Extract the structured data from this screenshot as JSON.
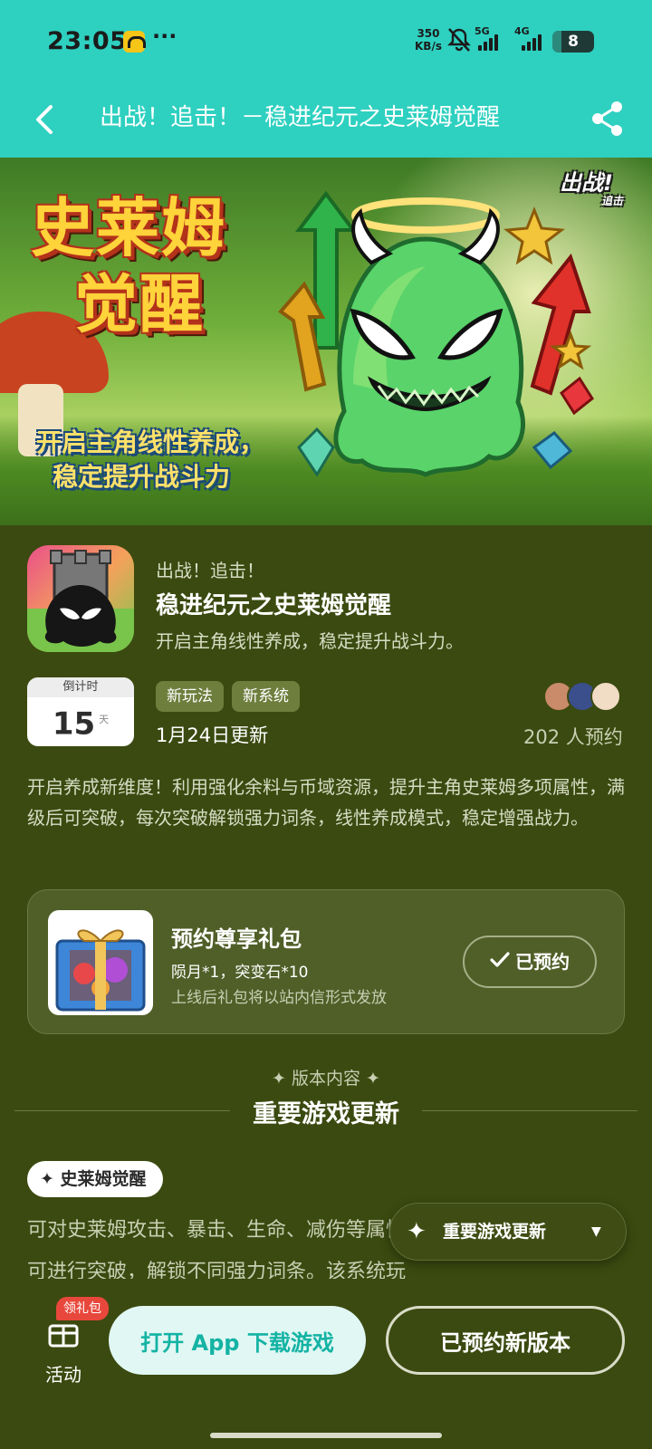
{
  "status_bar": {
    "time": "23:05",
    "more": "···",
    "speed_value": "350",
    "speed_unit": "KB/s",
    "net1": "5G",
    "net2": "4G",
    "battery": "8"
  },
  "nav": {
    "title": "出战！追击！－稳进纪元之史莱姆觉醒"
  },
  "banner": {
    "title_line1": "史莱姆",
    "title_line2": "觉醒",
    "subtitle_line1": "开启主角线性养成，",
    "subtitle_line2": "稳定提升战斗力",
    "badge": "出战!",
    "badge_small": "追击"
  },
  "game": {
    "line1": "出战！追击！",
    "line2": "稳进纪元之史莱姆觉醒",
    "line3": "开启主角线性养成，稳定提升战斗力。",
    "countdown_label": "倒计时",
    "countdown_days": "15",
    "countdown_unit": "天",
    "tags": [
      "新玩法",
      "新系统"
    ],
    "update_date": "1月24日更新",
    "reserve_count": "202 人预约",
    "description": "开启养成新维度！利用强化余料与币域资源，提升主角史莱姆多项属性，满级后可突破，每次突破解锁强力词条，线性养成模式，稳定增强战力。"
  },
  "gift": {
    "title": "预约尊享礼包",
    "items": "陨月*1，突变石*10",
    "note": "上线后礼包将以站内信形式发放",
    "button": "已预约"
  },
  "version": {
    "small_title": "✦ 版本内容 ✦",
    "title": "重要游戏更新",
    "feature_label": "史莱姆觉醒",
    "feature_text": "可对史莱姆攻击、暴击、生命、减伤等属性进行强化，升至满级后还可进行突破，解锁不同强力词条。该系统玩"
  },
  "float_jump": {
    "label": "重要游戏更新"
  },
  "bottom": {
    "activity_label": "活动",
    "gift_badge": "领礼包",
    "open_app": "打开 App 下载游戏",
    "reserved_version": "已预约新版本"
  },
  "colors": {
    "header": "#2ed0c0",
    "page_bg": "#3b4a10",
    "card_bg": "#505f28",
    "accent_text": "#14b3a4"
  },
  "icons": {
    "back": "chevron-left-icon",
    "share": "share-icon",
    "check": "check-icon",
    "activity": "gift-box-icon",
    "sparkle": "sparkle-icon",
    "caret": "caret-down-icon"
  }
}
